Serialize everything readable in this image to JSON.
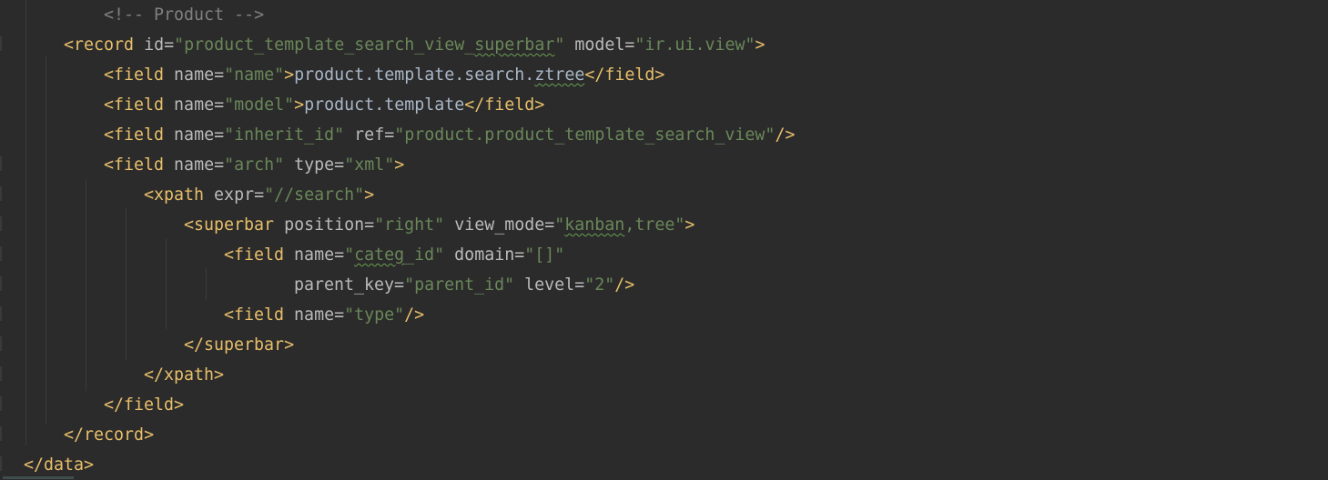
{
  "editor": {
    "language": "xml",
    "lines": [
      {
        "indent": 2,
        "tokens": [
          {
            "t": "cmt",
            "v": "<!-- Product -->"
          }
        ]
      },
      {
        "indent": 1,
        "tokens": [
          {
            "t": "br",
            "v": "<"
          },
          {
            "t": "tag",
            "v": "record"
          },
          {
            "t": "attr",
            "v": " id="
          },
          {
            "t": "val",
            "v": "\"product_template_search_view_"
          },
          {
            "t": "val squig",
            "v": "superbar"
          },
          {
            "t": "val",
            "v": "\""
          },
          {
            "t": "attr",
            "v": " model="
          },
          {
            "t": "val",
            "v": "\"ir.ui.view\""
          },
          {
            "t": "br",
            "v": ">"
          }
        ]
      },
      {
        "indent": 2,
        "tokens": [
          {
            "t": "br",
            "v": "<"
          },
          {
            "t": "tag",
            "v": "field"
          },
          {
            "t": "attr",
            "v": " name="
          },
          {
            "t": "val",
            "v": "\"name\""
          },
          {
            "t": "br",
            "v": ">"
          },
          {
            "t": "txt",
            "v": "product.template.search."
          },
          {
            "t": "txt squig",
            "v": "ztree"
          },
          {
            "t": "br",
            "v": "</"
          },
          {
            "t": "tag",
            "v": "field"
          },
          {
            "t": "br",
            "v": ">"
          }
        ]
      },
      {
        "indent": 2,
        "tokens": [
          {
            "t": "br",
            "v": "<"
          },
          {
            "t": "tag",
            "v": "field"
          },
          {
            "t": "attr",
            "v": " name="
          },
          {
            "t": "val",
            "v": "\"model\""
          },
          {
            "t": "br",
            "v": ">"
          },
          {
            "t": "txt",
            "v": "product.template"
          },
          {
            "t": "br",
            "v": "</"
          },
          {
            "t": "tag",
            "v": "field"
          },
          {
            "t": "br",
            "v": ">"
          }
        ]
      },
      {
        "indent": 2,
        "tokens": [
          {
            "t": "br",
            "v": "<"
          },
          {
            "t": "tag",
            "v": "field"
          },
          {
            "t": "attr",
            "v": " name="
          },
          {
            "t": "val",
            "v": "\"inherit_id\""
          },
          {
            "t": "attr",
            "v": " ref="
          },
          {
            "t": "val",
            "v": "\"product.product_template_search_view\""
          },
          {
            "t": "br",
            "v": "/>"
          }
        ]
      },
      {
        "indent": 2,
        "tokens": [
          {
            "t": "br",
            "v": "<"
          },
          {
            "t": "tag",
            "v": "field"
          },
          {
            "t": "attr",
            "v": " name="
          },
          {
            "t": "val",
            "v": "\"arch\""
          },
          {
            "t": "attr",
            "v": " type="
          },
          {
            "t": "val",
            "v": "\"xml\""
          },
          {
            "t": "br",
            "v": ">"
          }
        ]
      },
      {
        "indent": 3,
        "tokens": [
          {
            "t": "br",
            "v": "<"
          },
          {
            "t": "tag",
            "v": "xpath"
          },
          {
            "t": "attr",
            "v": " expr="
          },
          {
            "t": "val",
            "v": "\"//search\""
          },
          {
            "t": "br",
            "v": ">"
          }
        ]
      },
      {
        "indent": 4,
        "tokens": [
          {
            "t": "br",
            "v": "<"
          },
          {
            "t": "tag",
            "v": "superbar"
          },
          {
            "t": "attr",
            "v": " position="
          },
          {
            "t": "val",
            "v": "\"right\""
          },
          {
            "t": "attr",
            "v": " view_mode="
          },
          {
            "t": "val",
            "v": "\""
          },
          {
            "t": "val squig",
            "v": "kanban"
          },
          {
            "t": "val",
            "v": ",tree\""
          },
          {
            "t": "br",
            "v": ">"
          }
        ]
      },
      {
        "indent": 5,
        "tokens": [
          {
            "t": "br",
            "v": "<"
          },
          {
            "t": "tag",
            "v": "field"
          },
          {
            "t": "attr",
            "v": " name="
          },
          {
            "t": "val",
            "v": "\""
          },
          {
            "t": "val squig",
            "v": "categ"
          },
          {
            "t": "val",
            "v": "_id\""
          },
          {
            "t": "attr",
            "v": " domain="
          },
          {
            "t": "val",
            "v": "\"[]\""
          }
        ]
      },
      {
        "indent": 5,
        "extra": 7,
        "tokens": [
          {
            "t": "attr",
            "v": "parent_key="
          },
          {
            "t": "val",
            "v": "\"parent_id\""
          },
          {
            "t": "attr",
            "v": " level="
          },
          {
            "t": "val",
            "v": "\"2\""
          },
          {
            "t": "br",
            "v": "/>"
          }
        ]
      },
      {
        "indent": 5,
        "tokens": [
          {
            "t": "br",
            "v": "<"
          },
          {
            "t": "tag",
            "v": "field"
          },
          {
            "t": "attr",
            "v": " name="
          },
          {
            "t": "val",
            "v": "\"type\""
          },
          {
            "t": "br",
            "v": "/>"
          }
        ]
      },
      {
        "indent": 4,
        "tokens": [
          {
            "t": "br",
            "v": "</"
          },
          {
            "t": "tag",
            "v": "superbar"
          },
          {
            "t": "br",
            "v": ">"
          }
        ]
      },
      {
        "indent": 3,
        "tokens": [
          {
            "t": "br",
            "v": "</"
          },
          {
            "t": "tag",
            "v": "xpath"
          },
          {
            "t": "br",
            "v": ">"
          }
        ]
      },
      {
        "indent": 2,
        "tokens": [
          {
            "t": "br",
            "v": "</"
          },
          {
            "t": "tag",
            "v": "field"
          },
          {
            "t": "br",
            "v": ">"
          }
        ]
      },
      {
        "indent": 1,
        "tokens": [
          {
            "t": "br",
            "v": "</"
          },
          {
            "t": "tag",
            "v": "record"
          },
          {
            "t": "br",
            "v": ">"
          }
        ]
      },
      {
        "indent": 0,
        "tokens": [
          {
            "t": "br",
            "v": "</"
          },
          {
            "t": "tag",
            "v": "data"
          },
          {
            "t": "br",
            "v": ">"
          }
        ]
      }
    ]
  }
}
